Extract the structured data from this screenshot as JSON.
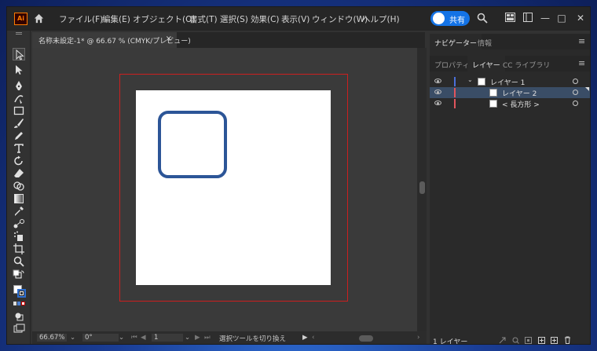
{
  "app": {
    "logo_text": "Ai",
    "accent": "#ff7c00",
    "menu": [
      "ファイル(F)",
      "編集(E)",
      "オブジェクト(O)",
      "書式(T)",
      "選択(S)",
      "効果(C)",
      "表示(V)",
      "ウィンドウ(W)",
      "ヘルプ(H)"
    ],
    "share_label": "共有",
    "share_color": "#1473e6"
  },
  "window_controls": {
    "minimize": "—",
    "maximize": "□",
    "close": "✕"
  },
  "document": {
    "tab_title": "名称未設定-1* @ 66.67 % (CMYK/プレビュー)",
    "tab_close": "×",
    "rect_stroke_color": "#2c5597",
    "bleed_color": "#cc1f1f"
  },
  "statusbar": {
    "zoom": "66.67%",
    "rotation": "0°",
    "artboard": "1",
    "tool_hint": "選択ツールを切り換え"
  },
  "panels": {
    "top_tabs": [
      "ナビゲーター",
      "情報"
    ],
    "sub_tabs": [
      "プロパティ",
      "レイヤー",
      "CC ライブラリ"
    ],
    "layers": [
      {
        "name": "レイヤー 1",
        "color": "#4a6fd8"
      },
      {
        "name": "レイヤー 2",
        "color": "#e0555d"
      },
      {
        "name": "< 長方形 >",
        "color": "#e0555d"
      }
    ],
    "footer_count": "1 レイヤー"
  },
  "icons": [
    "home-icon",
    "search-icon",
    "arrange-documents-icon",
    "workspace-icon",
    "selection-tool-icon",
    "direct-selection-tool-icon",
    "pen-tool-icon",
    "curvature-tool-icon",
    "rectangle-tool-icon",
    "paintbrush-tool-icon",
    "pencil-tool-icon",
    "type-tool-icon",
    "rotate-tool-icon",
    "eraser-tool-icon",
    "shape-builder-tool-icon",
    "gradient-tool-icon",
    "eyedropper-tool-icon",
    "blend-tool-icon",
    "symbol-sprayer-tool-icon",
    "artboard-tool-icon",
    "zoom-tool-icon",
    "fill-stroke-icon",
    "edit-toolbar-icon",
    "eye-icon",
    "new-layer-icon",
    "trash-icon"
  ]
}
